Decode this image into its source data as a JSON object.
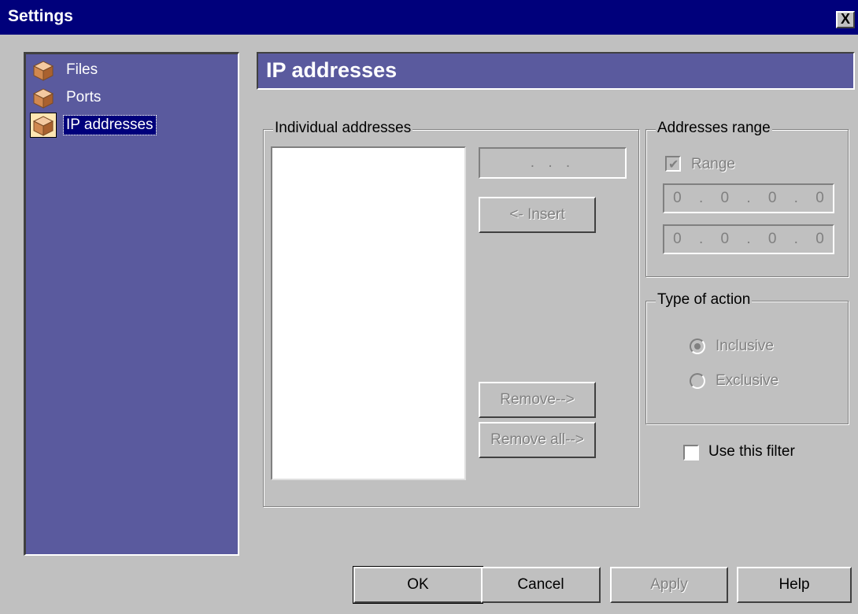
{
  "window": {
    "title": "Settings",
    "close_glyph": "X"
  },
  "sidebar": {
    "items": [
      {
        "label": "Files",
        "icon": "package-icon",
        "selected": false
      },
      {
        "label": "Ports",
        "icon": "package-icon",
        "selected": false
      },
      {
        "label": "IP addresses",
        "icon": "package-icon",
        "selected": true
      }
    ]
  },
  "page": {
    "title": "IP addresses"
  },
  "individual": {
    "legend": "Individual addresses",
    "ip_placeholder": ".     .     .",
    "insert_label": "<- Insert",
    "remove_label": "Remove-->",
    "remove_all_label": "Remove all-->"
  },
  "range": {
    "legend": "Addresses range",
    "checkbox_label": "Range",
    "checked": true,
    "start_octets": [
      "0",
      ".",
      "0",
      ".",
      "0",
      ".",
      "0"
    ],
    "end_octets": [
      "0",
      ".",
      "0",
      ".",
      "0",
      ".",
      "0"
    ]
  },
  "action": {
    "legend": "Type of action",
    "options": [
      {
        "label": "Inclusive",
        "selected": true
      },
      {
        "label": "Exclusive",
        "selected": false
      }
    ]
  },
  "filter": {
    "label": "Use this filter",
    "checked": false
  },
  "buttons": {
    "ok": "OK",
    "cancel": "Cancel",
    "apply": "Apply",
    "help": "Help"
  },
  "colors": {
    "titlebar": "#00007b",
    "panel": "#5a5a9e",
    "face": "#c0c0c0"
  }
}
